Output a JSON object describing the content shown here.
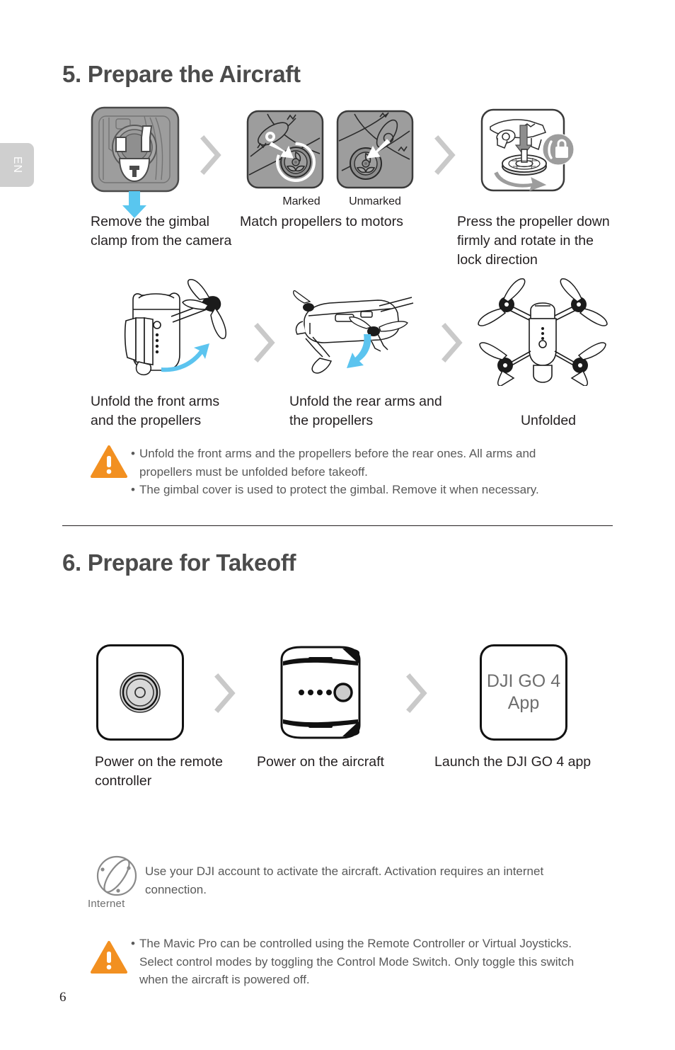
{
  "page": {
    "number": "6",
    "language_tab": "EN"
  },
  "sections": [
    {
      "id": "prepare-aircraft",
      "title": "5. Prepare the Aircraft",
      "row1": {
        "steps": [
          {
            "icon": "gimbal-clamp-removal-icon",
            "caption": "Remove the gimbal clamp from the camera"
          },
          {
            "icon": "marked-propeller-motor-icon",
            "sublabel": "Marked",
            "caption": "Match propellers to motors"
          },
          {
            "icon": "unmarked-propeller-motor-icon",
            "sublabel": "Unmarked"
          },
          {
            "icon": "propeller-lock-rotate-icon",
            "caption": "Press the propeller down firmly and rotate in the lock direction"
          }
        ]
      },
      "row2": {
        "steps": [
          {
            "icon": "unfold-front-arms-icon",
            "caption": "Unfold the front arms and the propellers"
          },
          {
            "icon": "unfold-rear-arms-icon",
            "caption": "Unfold the rear arms and the propellers"
          },
          {
            "icon": "unfolded-aircraft-icon",
            "caption": "Unfolded"
          }
        ]
      },
      "warning": {
        "icon": "warning-triangle-icon",
        "bullets": [
          "Unfold the front arms and the propellers before the rear ones. All arms and propellers must be unfolded before takeoff.",
          "The gimbal cover is used to protect the gimbal. Remove it when necessary."
        ]
      }
    },
    {
      "id": "prepare-takeoff",
      "title": "6. Prepare for Takeoff",
      "steps": [
        {
          "icon": "remote-controller-power-button-icon",
          "caption": "Power on the remote controller"
        },
        {
          "icon": "aircraft-battery-power-button-icon",
          "caption": "Power on the aircraft"
        },
        {
          "icon": "dji-go-4-app-icon",
          "app_line1": "DJI GO 4",
          "app_line2": "App",
          "caption": "Launch the DJI GO 4 app"
        }
      ],
      "internet_note": {
        "icon": "internet-globe-icon",
        "label": "Internet",
        "text": "Use your DJI account to activate the aircraft. Activation requires an internet connection."
      },
      "warning": {
        "icon": "warning-triangle-icon",
        "bullets": [
          "The Mavic Pro can be controlled using the Remote Controller or Virtual Joysticks. Select control modes by toggling the Control Mode Switch. Only toggle this switch when the aircraft is powered off."
        ]
      }
    }
  ],
  "colors": {
    "heading": "#4b4b4b",
    "body": "#231f20",
    "note_text": "#595959",
    "warning_orange": "#f29021",
    "chevron_gray": "#c9c9c9",
    "arrow_blue": "#4fc3ee",
    "panel_gray": "#9d9d9d",
    "lang_tab_gray": "#cfcfcf"
  }
}
